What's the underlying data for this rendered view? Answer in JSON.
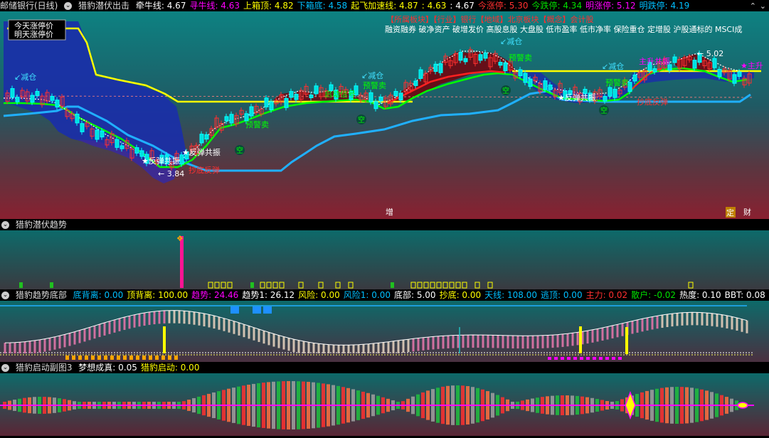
{
  "colors": {
    "cyan": "#00bfff",
    "yellow": "#ffff00",
    "red": "#ff3030",
    "green": "#00e000",
    "magenta": "#ff00ff",
    "white": "#ffffff",
    "blue": "#4080ff"
  },
  "main_header": {
    "stock": "邮储银行(日线)",
    "indicator": "猎豹潜伏出击",
    "items": [
      {
        "label": "牵牛线: 4.67",
        "color": "#ffffff"
      },
      {
        "label": "寻牛线: 4.63",
        "color": "#ff00ff"
      },
      {
        "label": "上箱顶: 4.82",
        "color": "#ffff00"
      },
      {
        "label": "下箱底: 4.58",
        "color": "#00bfff"
      },
      {
        "label": "起飞加速线: 4.87",
        "color": "#ffff00"
      },
      {
        "label": ": 4.63",
        "color": "#ffff00"
      },
      {
        "label": ": 4.67",
        "color": "#ffffff"
      },
      {
        "label": "今涨停: 5.30",
        "color": "#ff3030"
      },
      {
        "label": "今跌停: 4.34",
        "color": "#00e000"
      },
      {
        "label": "明涨停: 5.12",
        "color": "#ff00ff"
      },
      {
        "label": "明跌停: 4.19",
        "color": "#00bfff"
      }
    ]
  },
  "legend_box": {
    "line1": "今天涨停价",
    "line2": "明天涨停价"
  },
  "sector_line": "【所属板块】【行业】银行【地域】北京板块【概念】会计股",
  "concept_line": "融资融券 破净资产 破增发价 高股息股 大盘股 低市盈率 低市净率 保险重仓 定增股 沪股通标的 MSCI成",
  "annotations": {
    "jiancang": "减仓",
    "yujingmai": "预警卖",
    "fantan": "反弹共振",
    "chaodi": "抄底反弹",
    "kong": "空",
    "zhusheng": "主升",
    "lowprice": "3.84",
    "highprice": "5.02",
    "gongzhen": "主升共振",
    "kaishi": "启动信号"
  },
  "bottom_tags": {
    "zeng": "增",
    "ding": "定",
    "cai": "财"
  },
  "panel2_header": {
    "title": "猎豹潜伏趋势"
  },
  "panel3_header": {
    "title": "猎豹趋势底部",
    "items": [
      {
        "label": "底背离: 0.00",
        "color": "#00bfff"
      },
      {
        "label": "顶背离: 100.00",
        "color": "#ffff00"
      },
      {
        "label": "趋势: 24.46",
        "color": "#ff00ff"
      },
      {
        "label": "趋势1: 26.12",
        "color": "#ffffff"
      },
      {
        "label": "风险: 0.00",
        "color": "#ffff00"
      },
      {
        "label": "风险1: 0.00",
        "color": "#00bfff"
      },
      {
        "label": "底部: 5.00",
        "color": "#ffffff"
      },
      {
        "label": "抄底: 0.00",
        "color": "#ffff00"
      },
      {
        "label": "天线: 108.00",
        "color": "#00bfff"
      },
      {
        "label": "逃顶: 0.00",
        "color": "#00bfff"
      },
      {
        "label": "主力: 0.02",
        "color": "#ff3030"
      },
      {
        "label": "散户: -0.02",
        "color": "#00e000"
      },
      {
        "label": "热度: 0.10",
        "color": "#ffffff"
      },
      {
        "label": "BBT: 0.08",
        "color": "#ffffff"
      }
    ]
  },
  "panel4_header": {
    "title": "猎豹启动副图3",
    "items": [
      {
        "label": "梦想成真: 0.05",
        "color": "#ffffff"
      },
      {
        "label": "猎豹启动: 0.00",
        "color": "#ffff00"
      }
    ]
  }
}
